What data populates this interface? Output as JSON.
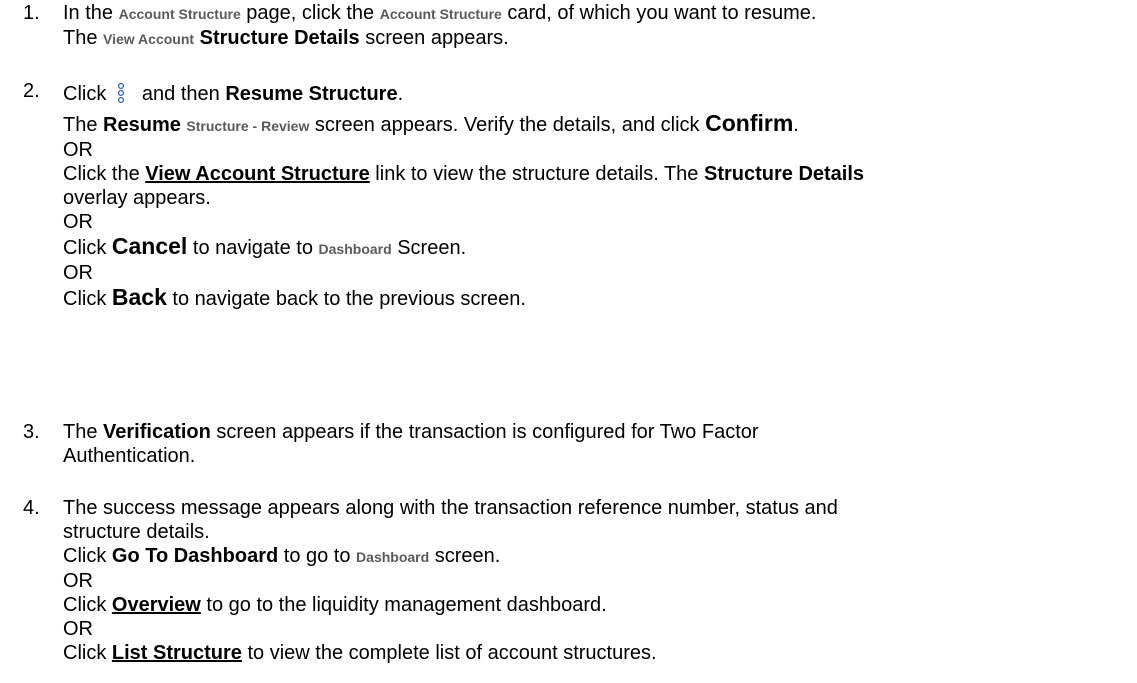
{
  "steps": [
    {
      "num": "1.",
      "pre": " In the ",
      "term1": "Account Structure",
      "mid": " page, click the ",
      "term2": "Account Structure",
      "post": " card, of which you want to resume.",
      "l2_pre": "The ",
      "l2_small": "View Account",
      "l2_space": " ",
      "l2_bold": "Structure Details",
      "l2_post": " screen appears."
    },
    {
      "num": "2.",
      "click": "Click",
      "kebab_icon": "kebab-menu-icon",
      "and_then": " and then ",
      "resume": "Resume Structure",
      "resume_end": ".",
      "the1": "The ",
      "resume_word": "Resume",
      "space1": " ",
      "structure_review": "Structure - Review",
      "review_post": " screen appears. Verify the details, and click ",
      "confirm": "Confirm",
      "confirm_end": ".",
      "or1": "OR",
      "click_the": "Click the ",
      "view_link": "View Account Structure",
      "view_post": " link to view the structure details. The ",
      "structure_details": "Structure Details",
      "overlay": "overlay appears.",
      "or2": "OR",
      "click_c": "Click ",
      "cancel": "Cancel",
      "cancel_post": " to navigate to ",
      "dashboard": "Dashboard",
      "screen_end": " Screen.",
      "or3": "OR",
      "click_b": "Click ",
      "back": "Back",
      "back_post": " to navigate back to the previous screen."
    },
    {
      "num": "3.",
      "the": "The ",
      "verification": "Verification",
      "line1_post": " screen appears if the transaction is configured for Two Factor",
      "line2": "Authentication."
    },
    {
      "num": "4.",
      "line1": "The success message appears along with the transaction reference number, status and",
      "line2": "structure details.",
      "click_g": "Click ",
      "go_to_dashboard": "Go To Dashboard",
      "go_post": " to go to ",
      "dashboard": "Dashboard",
      "go_end": " screen.",
      "or1": "OR",
      "click_o": "Click ",
      "overview": "Overview",
      "overview_post": " to go to the liquidity management dashboard.",
      "or2": "OR",
      "click_l": "Click ",
      "list_structure": "List Structure",
      "list_post": " to view the complete list of account structures."
    }
  ],
  "colors": {
    "text": "#000000",
    "small_label": "#5a5a5a",
    "icon": "#3b6fb6"
  }
}
